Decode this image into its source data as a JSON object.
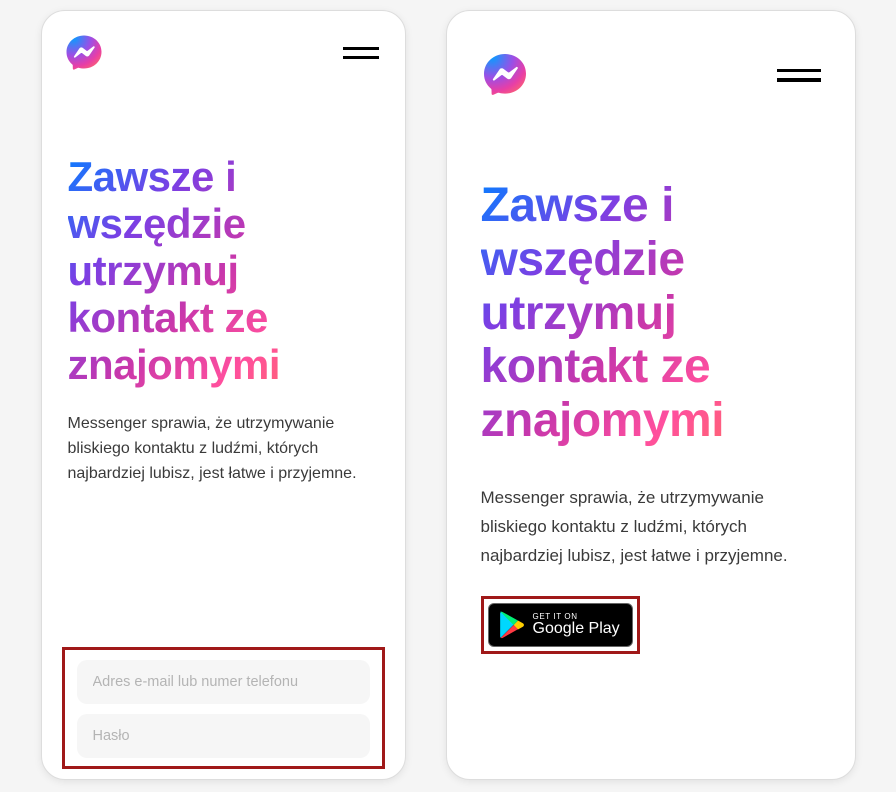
{
  "headline": "Zawsze i wszędzie utrzymuj kontakt ze znajomymi",
  "subtext": "Messenger sprawia, że utrzymywanie bliskiego kontaktu z ludźmi, których najbardziej lubisz, jest łatwe i przyjemne.",
  "form": {
    "email_placeholder": "Adres e-mail lub numer telefonu",
    "password_placeholder": "Hasło"
  },
  "gplay": {
    "top": "GET IT ON",
    "bottom": "Google Play"
  }
}
